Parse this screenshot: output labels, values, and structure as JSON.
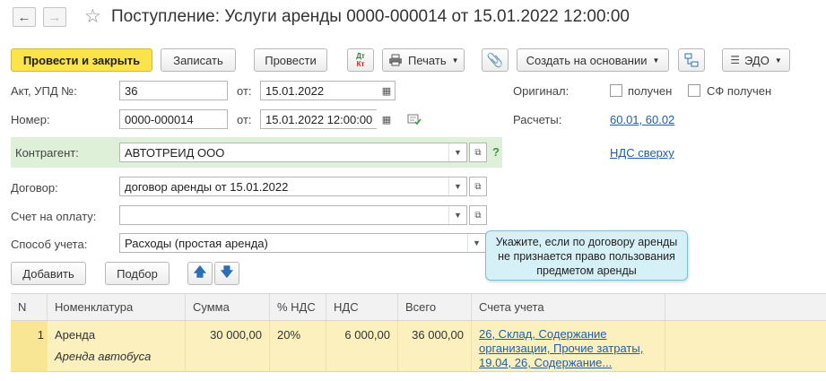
{
  "window": {
    "title": "Поступление: Услуги аренды 0000-000014 от 15.01.2022 12:00:00",
    "back_glyph": "←",
    "forward_glyph": "→",
    "star_glyph": "☆"
  },
  "toolbar": {
    "post_close": "Провести и закрыть",
    "save": "Записать",
    "post": "Провести",
    "dtkt_top": "Дт",
    "dtkt_bottom": "Кт",
    "print": "Печать",
    "create_based": "Создать на основании",
    "edo": "ЭДО"
  },
  "form": {
    "act_label": "Акт, УПД №:",
    "act_value": "36",
    "from_label": "от:",
    "act_date": "15.01.2022",
    "number_label": "Номер:",
    "number_value": "0000-000014",
    "number_date": "15.01.2022 12:00:00",
    "original_label": "Оригинал:",
    "received_label": "получен",
    "sf_received_label": "СФ получен",
    "settlements_label": "Расчеты:",
    "settlements_link": "60.01, 60.02",
    "vat_link": "НДС сверху",
    "counterparty_label": "Контрагент:",
    "counterparty_value": "АВТОТРЕИД ООО",
    "help_glyph": "?",
    "contract_label": "Договор:",
    "contract_value": "договор аренды от 15.01.2022",
    "invoice_label": "Счет на оплату:",
    "invoice_value": "",
    "method_label": "Способ учета:",
    "method_value": "Расходы (простая аренда)"
  },
  "tooltip": {
    "text": "Укажите, если по договору аренды не признается право пользования предметом аренды"
  },
  "table_toolbar": {
    "add": "Добавить",
    "pick": "Подбор"
  },
  "table": {
    "columns": [
      "N",
      "Номенклатура",
      "Сумма",
      "% НДС",
      "НДС",
      "Всего",
      "Счета учета"
    ],
    "rows": [
      {
        "n": "1",
        "item": "Аренда",
        "item_sub": "Аренда автобуса",
        "sum": "30 000,00",
        "vat_rate": "20%",
        "vat": "6 000,00",
        "total": "36 000,00",
        "accounts_1": "26, Склад, Содержание",
        "accounts_2": "организации, Прочие затраты,",
        "accounts_3": "19.04, 26, Содержание..."
      }
    ]
  },
  "colors": {
    "primary_button": "#fbe34a",
    "counterparty_bg": "#dff0d8",
    "link": "#1b5fb0",
    "tooltip_bg": "#d5f0f7",
    "selected_row": "#fbf0be"
  }
}
